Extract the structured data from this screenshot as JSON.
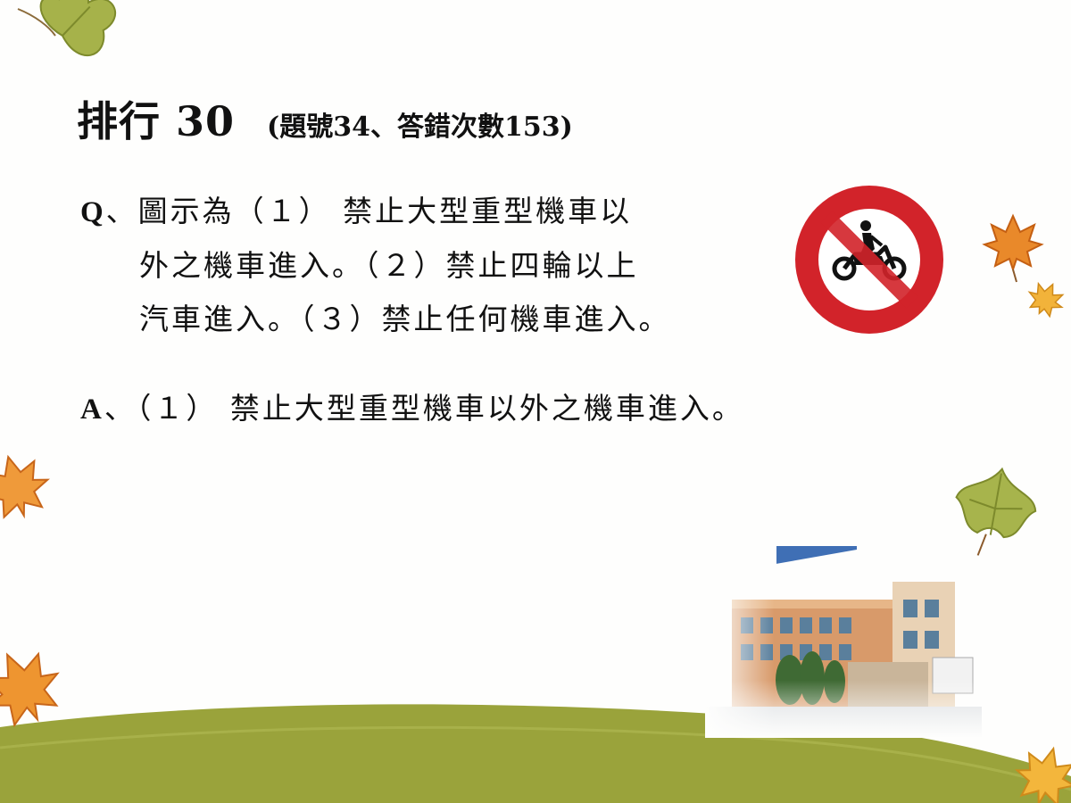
{
  "title": {
    "main": "排行 30",
    "sub": "(題號34、答錯次數153)"
  },
  "question": {
    "label": "Q",
    "line1": "、圖示為（１） 禁止大型重型機車以",
    "line2": "外之機車進入。（２）禁止四輪以上",
    "line3": "汽車進入。（３）禁止任何機車進入。"
  },
  "answer": {
    "label": "A",
    "text": "、（１） 禁止大型重型機車以外之機車進入。"
  },
  "sign": {
    "icon": "no-motorcycle-sign-icon",
    "ring_color": "#d2232a"
  },
  "colors": {
    "ground": "#9aa33b",
    "leaf_green": "#a6b24a",
    "leaf_orange": "#e9892a",
    "leaf_yellow": "#f2b33a"
  }
}
